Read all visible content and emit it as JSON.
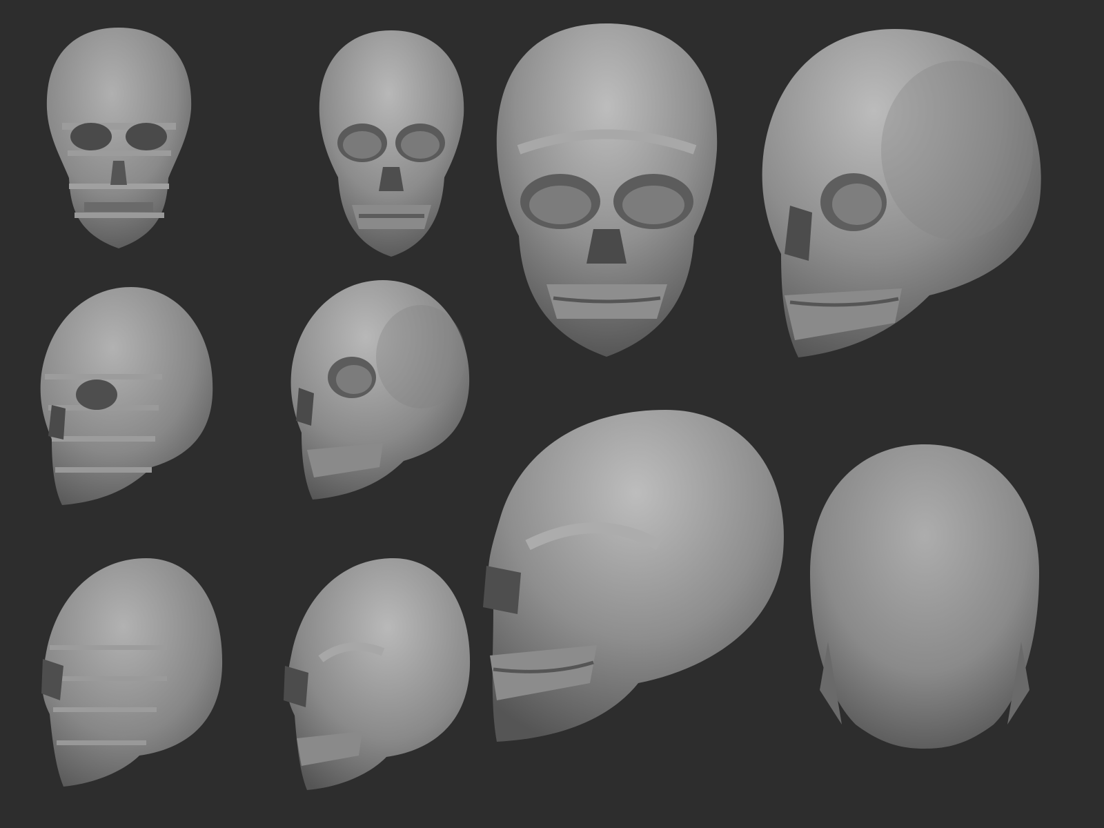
{
  "scene": {
    "background": "#2d2d2d",
    "material_light": "#a6a6a6",
    "material_mid": "#7e7e7e",
    "material_dark": "#3a3a3a"
  },
  "skulls": [
    {
      "view": "front",
      "detail": "blocky"
    },
    {
      "view": "front",
      "detail": "refined"
    },
    {
      "view": "front",
      "detail": "smooth"
    },
    {
      "view": "three-quarter",
      "detail": "smooth"
    },
    {
      "view": "three-quarter",
      "detail": "blocky"
    },
    {
      "view": "three-quarter",
      "detail": "refined"
    },
    {
      "view": "side",
      "detail": "blocky"
    },
    {
      "view": "side",
      "detail": "refined"
    },
    {
      "view": "side",
      "detail": "smooth"
    },
    {
      "view": "back",
      "detail": "smooth"
    }
  ]
}
